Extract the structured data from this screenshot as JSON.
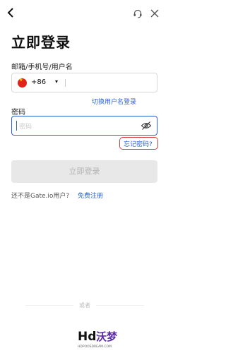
{
  "header": {
    "back_icon": "chevron-left-icon",
    "support_icon": "headset-icon",
    "close_icon": "close-icon"
  },
  "title": "立即登录",
  "account": {
    "label": "邮箱/手机号/用户名",
    "country_flag": "china-flag-icon",
    "country_code": "+86",
    "caret": "▾"
  },
  "switch_link": "切换用户名登录",
  "password": {
    "label": "密码",
    "placeholder": "密码",
    "toggle_icon": "eye-off-icon"
  },
  "forgot_link": "忘记密码?",
  "login_button": "立即登录",
  "register": {
    "prompt": "还不是Gate.io用户?",
    "link": "免费注册"
  },
  "or_text": "或者",
  "watermark": {
    "main": "Hd沃梦",
    "sub": "HDPOOSDREAM.COM"
  },
  "colors": {
    "accent": "#2b63d6",
    "highlight_border": "#d8383c",
    "disabled_button": "#e8e8e8"
  }
}
